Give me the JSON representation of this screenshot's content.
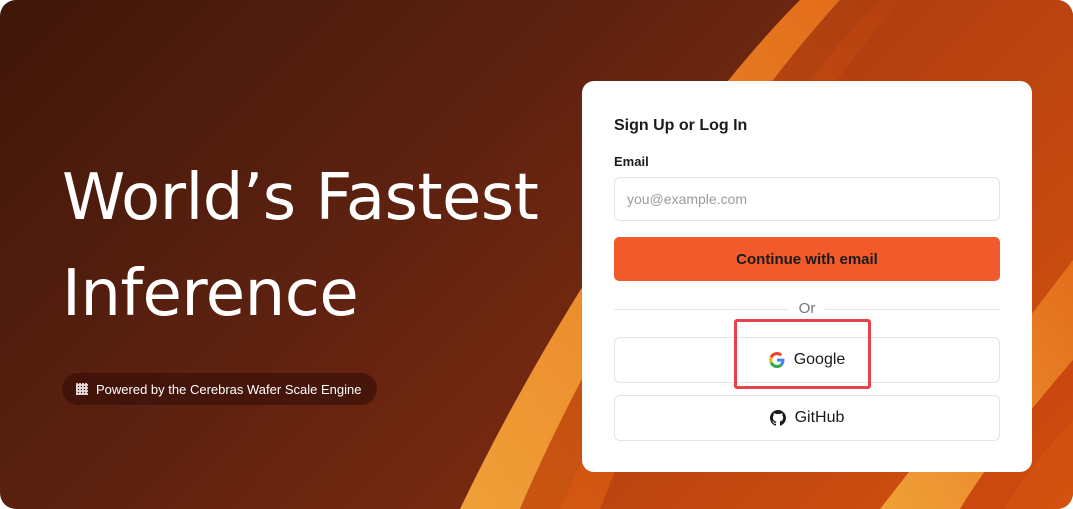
{
  "hero": {
    "title_line1": "World’s Fastest",
    "title_line2": "Inference",
    "badge_text": "Powered by the Cerebras Wafer Scale Engine",
    "badge_icon": "chip-icon"
  },
  "signin": {
    "title": "Sign Up or Log In",
    "email_label": "Email",
    "email_value": "",
    "email_placeholder": "you@example.com",
    "continue_label": "Continue with email",
    "divider_text": "Or",
    "google_label": "Google",
    "google_icon": "google-icon",
    "github_label": "GitHub",
    "github_icon": "github-icon"
  },
  "colors": {
    "primary_button": "#f15a2b",
    "background_dark": "#4a1a0b",
    "accent_stripe": "#f0932a",
    "highlight_box": "#e8424c"
  }
}
